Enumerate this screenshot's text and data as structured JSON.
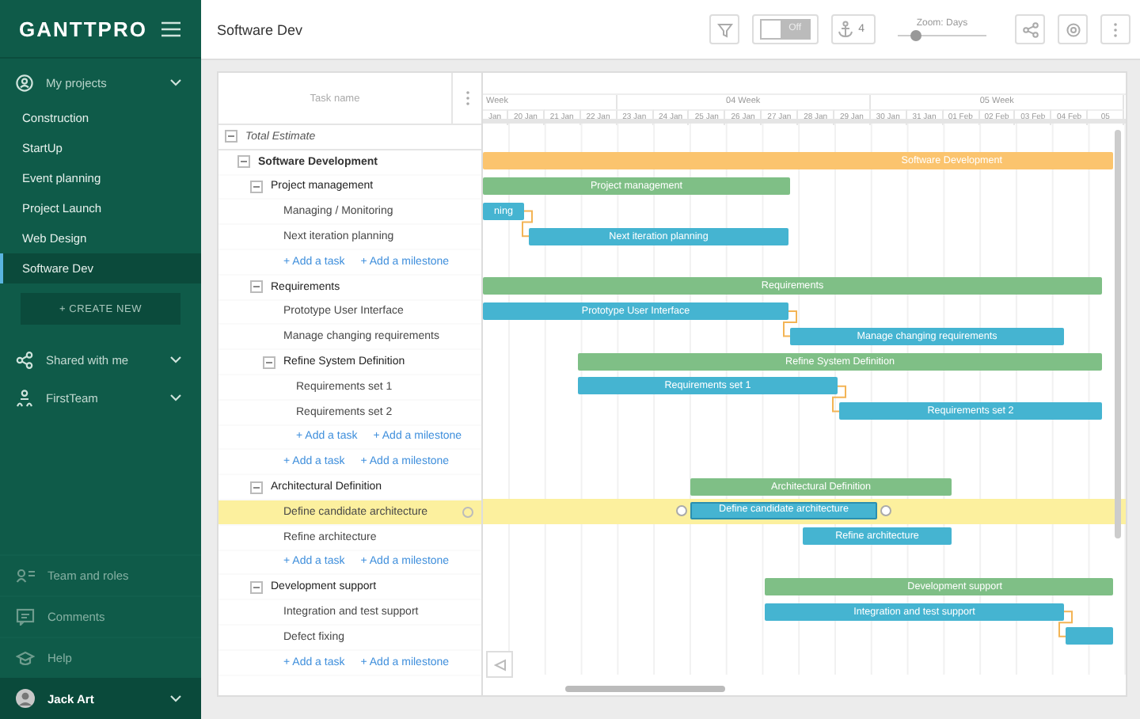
{
  "sidebar": {
    "logo": "GANTTPRO",
    "my_projects": "My projects",
    "projects": [
      {
        "name": "Construction",
        "selected": false
      },
      {
        "name": "StartUp",
        "selected": false
      },
      {
        "name": "Event planning",
        "selected": false
      },
      {
        "name": "Project Launch",
        "selected": false
      },
      {
        "name": "Web Design",
        "selected": false
      },
      {
        "name": "Software Dev",
        "selected": true
      }
    ],
    "create_button": "+ CREATE NEW",
    "groups": [
      "Shared with me",
      "FirstTeam"
    ],
    "bottom": [
      "Team and roles",
      "Comments",
      "Help"
    ],
    "user": "Jack Art"
  },
  "topbar": {
    "title": "Software Dev",
    "toggle": {
      "label": "Off",
      "on": false
    },
    "people_count": "4",
    "zoom": {
      "label": "Zoom: Days",
      "level": 0.2
    }
  },
  "gantt": {
    "grid_header": "Task name",
    "weeks": [
      "Week",
      "04 Week",
      "05 Week"
    ],
    "days": [
      "Jan",
      "20 Jan",
      "21 Jan",
      "22 Jan",
      "23 Jan",
      "24 Jan",
      "25 Jan",
      "26 Jan",
      "27 Jan",
      "28 Jan",
      "29 Jan",
      "30 Jan",
      "31 Jan",
      "01 Feb",
      "02 Feb",
      "03 Feb",
      "04 Feb",
      "05"
    ],
    "tree": [
      {
        "kind": "total",
        "name": "Total Estimate",
        "expanded": true,
        "selected": false,
        "children": [
          {
            "kind": "project",
            "name": "Software Development",
            "expanded": true,
            "selected": false,
            "bar": {
              "kind": "summary",
              "label": "Software Development"
            },
            "children": [
              {
                "kind": "group",
                "name": "Project management",
                "expanded": true,
                "selected": false,
                "bar": {
                  "kind": "group",
                  "label": "Project management"
                },
                "children": [
                  {
                    "kind": "task",
                    "name": "Managing / Monitoring",
                    "selected": false,
                    "bar": {
                      "kind": "task",
                      "label": "ning"
                    }
                  },
                  {
                    "kind": "task",
                    "name": "Next iteration planning",
                    "selected": false,
                    "bar": {
                      "kind": "task",
                      "label": "Next iteration planning"
                    }
                  },
                  {
                    "kind": "add",
                    "add_task": "+ Add a task",
                    "add_milestone": "+ Add a milestone"
                  }
                ]
              },
              {
                "kind": "group",
                "name": "Requirements",
                "expanded": true,
                "selected": false,
                "bar": {
                  "kind": "group",
                  "label": "Requirements"
                },
                "children": [
                  {
                    "kind": "task",
                    "name": "Prototype User Interface",
                    "selected": false,
                    "bar": {
                      "kind": "task",
                      "label": "Prototype User Interface"
                    }
                  },
                  {
                    "kind": "task",
                    "name": "Manage changing requirements",
                    "selected": false,
                    "bar": {
                      "kind": "task",
                      "label": "Manage changing requirements"
                    }
                  },
                  {
                    "kind": "group",
                    "name": "Refine System Definition",
                    "expanded": true,
                    "selected": false,
                    "bar": {
                      "kind": "group",
                      "label": "Refine System Definition"
                    },
                    "children": [
                      {
                        "kind": "task",
                        "name": "Requirements set 1",
                        "selected": false,
                        "bar": {
                          "kind": "task",
                          "label": "Requirements set 1"
                        }
                      },
                      {
                        "kind": "task",
                        "name": "Requirements set 2",
                        "selected": false,
                        "bar": {
                          "kind": "task",
                          "label": "Requirements set 2"
                        }
                      },
                      {
                        "kind": "add",
                        "add_task": "+ Add a task",
                        "add_milestone": "+ Add a milestone"
                      }
                    ]
                  },
                  {
                    "kind": "add",
                    "add_task": "+ Add a task",
                    "add_milestone": "+ Add a milestone"
                  }
                ]
              },
              {
                "kind": "group",
                "name": "Architectural Definition",
                "expanded": true,
                "selected": false,
                "bar": {
                  "kind": "group",
                  "label": "Architectural Definition"
                },
                "children": [
                  {
                    "kind": "task",
                    "name": "Define candidate architecture",
                    "selected": true,
                    "bar": {
                      "kind": "task",
                      "label": "Define candidate architecture"
                    }
                  },
                  {
                    "kind": "task",
                    "name": "Refine architecture",
                    "selected": false,
                    "bar": {
                      "kind": "task",
                      "label": "Refine architecture"
                    }
                  },
                  {
                    "kind": "add",
                    "add_task": "+ Add a task",
                    "add_milestone": "+ Add a milestone"
                  }
                ]
              },
              {
                "kind": "group",
                "name": "Development support",
                "expanded": true,
                "selected": false,
                "bar": {
                  "kind": "group",
                  "label": "Development support"
                },
                "children": [
                  {
                    "kind": "task",
                    "name": "Integration and test support",
                    "selected": false,
                    "bar": {
                      "kind": "task",
                      "label": "Integration and test support"
                    }
                  },
                  {
                    "kind": "task",
                    "name": "Defect fixing",
                    "selected": false,
                    "bar": {
                      "kind": "task"
                    }
                  },
                  {
                    "kind": "add",
                    "add_task": "+ Add a task",
                    "add_milestone": "+ Add a milestone"
                  }
                ]
              }
            ]
          }
        ]
      }
    ]
  }
}
